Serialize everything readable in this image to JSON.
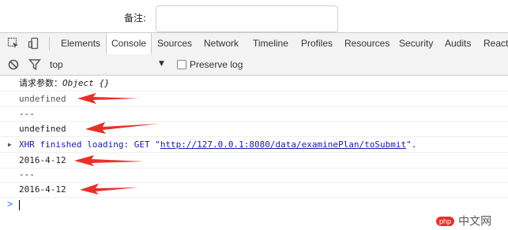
{
  "page": {
    "remark_label": "备注:",
    "remark_value": ""
  },
  "devtools": {
    "tabs": [
      {
        "label": "Elements",
        "active": false
      },
      {
        "label": "Console",
        "active": true
      },
      {
        "label": "Sources",
        "active": false
      },
      {
        "label": "Network",
        "active": false
      },
      {
        "label": "Timeline",
        "active": false
      },
      {
        "label": "Profiles",
        "active": false
      },
      {
        "label": "Resources",
        "active": false
      },
      {
        "label": "Security",
        "active": false
      },
      {
        "label": "Audits",
        "active": false
      },
      {
        "label": "React",
        "active": false
      }
    ],
    "toolbar": {
      "context": "top",
      "preserve_log_label": "Preserve log",
      "preserve_log_checked": false
    },
    "console": {
      "line1_label": "请求参数：",
      "line1_value": "Object {}",
      "line2": "undefined",
      "line3": "---",
      "line4": "undefined",
      "line5_prefix": "XHR finished loading: GET \"",
      "line5_url": "http://127.0.0.1:8080/data/examinePlan/toSubmit",
      "line5_suffix": "\".",
      "line6": "2016-4-12",
      "line7": "---",
      "line8": "2016-4-12",
      "prompt": ">"
    },
    "annotation_color": "#e8302a",
    "watermark": {
      "text": "中文网",
      "badge": "php"
    }
  }
}
